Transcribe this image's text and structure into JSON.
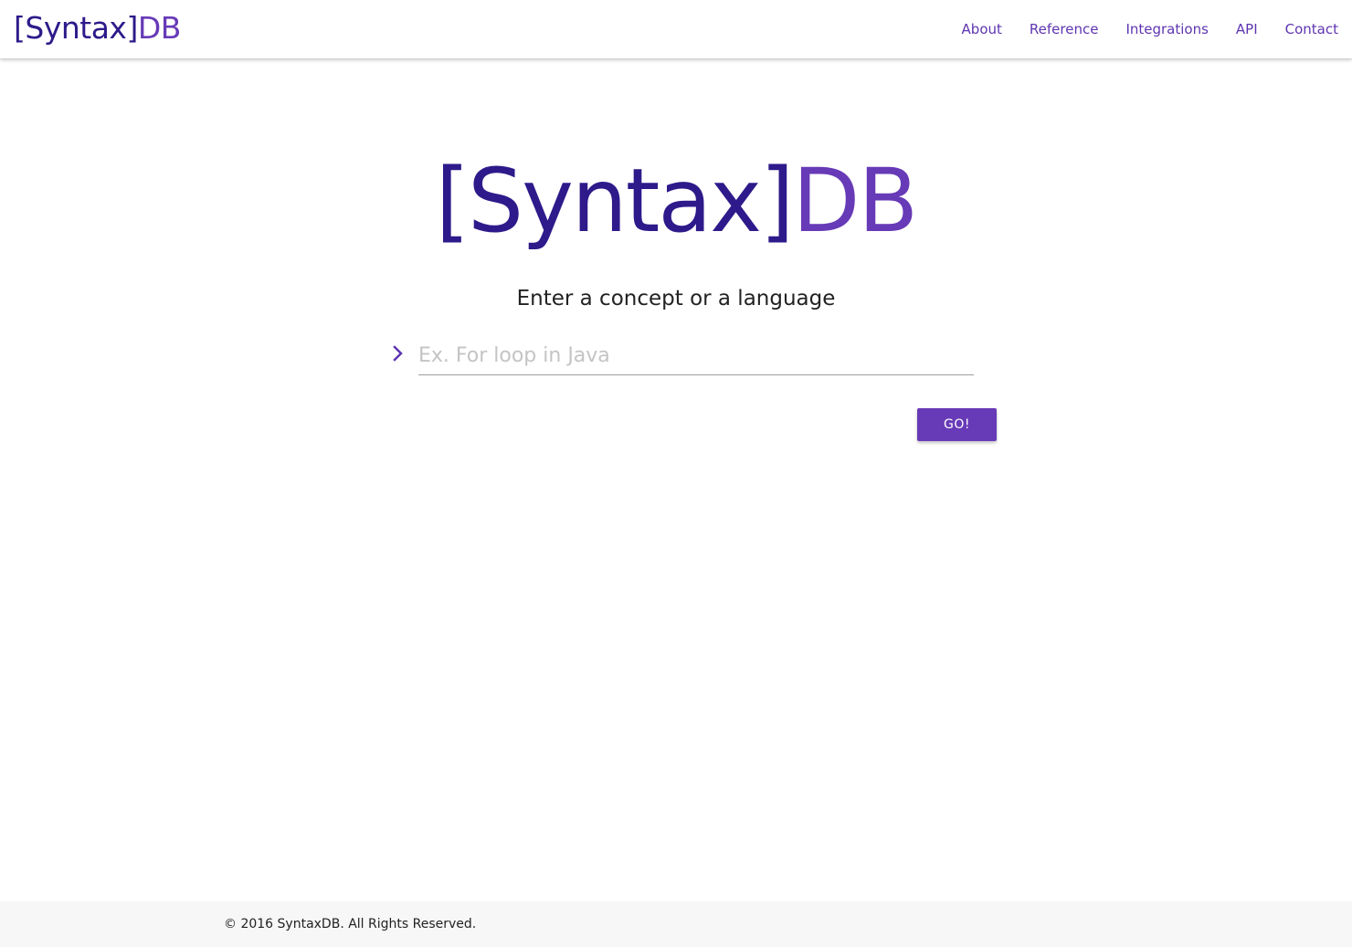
{
  "nav": {
    "brand_dark": "[Syntax]",
    "brand_light": "DB",
    "links": [
      "About",
      "Reference",
      "Integrations",
      "API",
      "Contact"
    ]
  },
  "hero": {
    "logo_dark": "[Syntax]",
    "logo_light": "DB",
    "prompt": "Enter a concept or a language"
  },
  "search": {
    "placeholder": "Ex. For loop in Java",
    "value": "",
    "icon": "chevron-right-icon"
  },
  "go_button_label": "GO!",
  "footer": {
    "text": "© 2016 SyntaxDB. All Rights Reserved."
  },
  "colors": {
    "brand_dark": "#2e1a8a",
    "brand_accent": "#673ab7",
    "footer_bg": "#f7f7f7"
  }
}
